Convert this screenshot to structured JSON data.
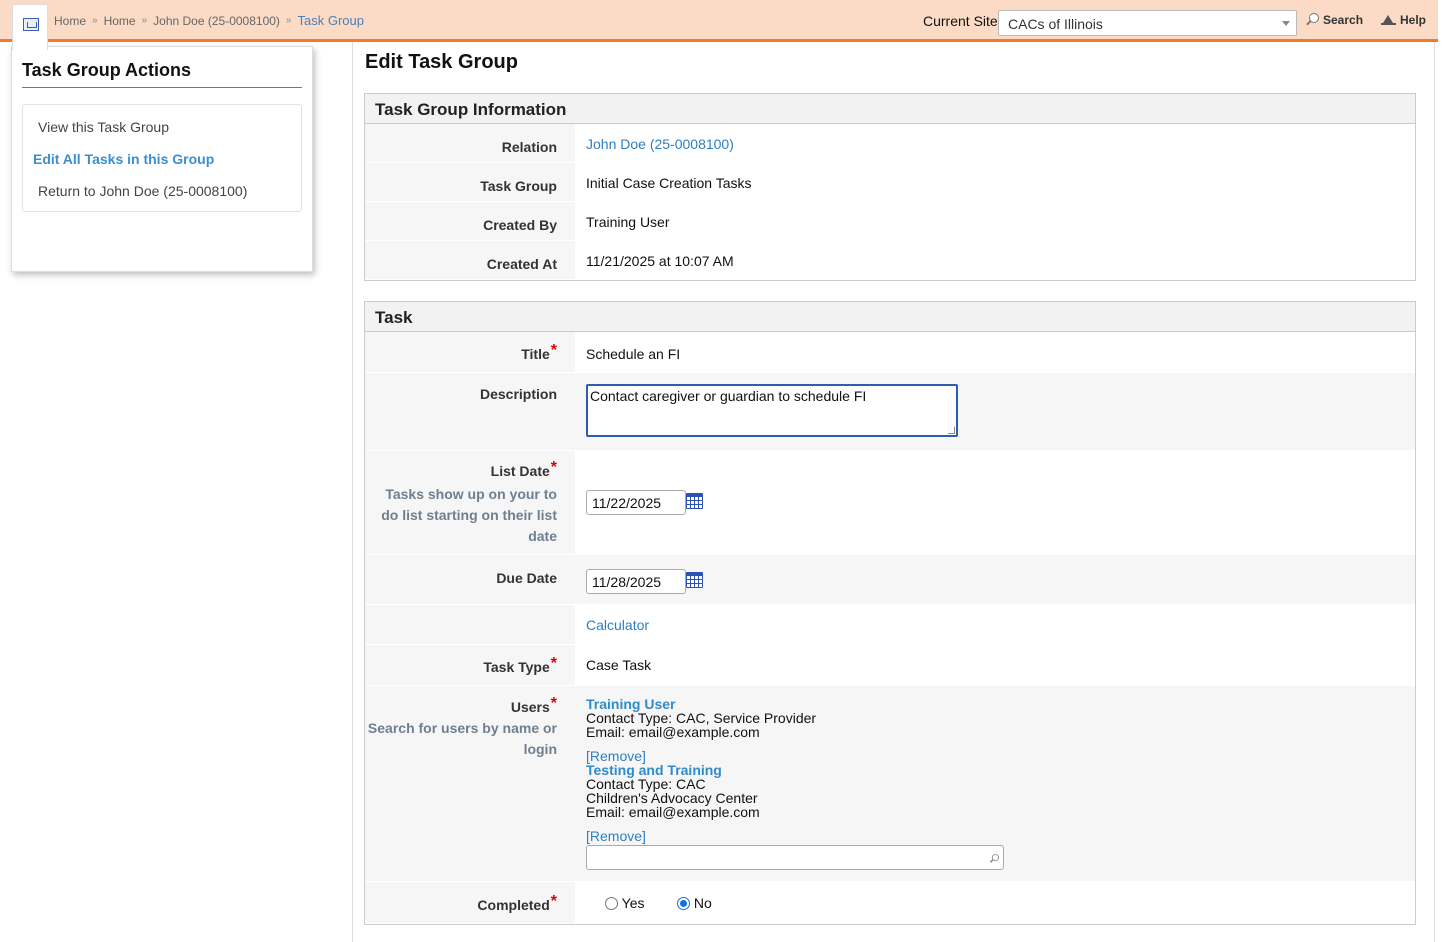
{
  "breadcrumb": {
    "items": [
      "Home",
      "Home",
      "John Doe (25-0008100)"
    ],
    "separator": "»",
    "current": "Task Group"
  },
  "header": {
    "current_site_label": "Current Site",
    "current_site_value": "CACs of Illinois",
    "search_label": "Search",
    "help_label": "Help"
  },
  "sidebar": {
    "title": "Task Group Actions",
    "items": [
      {
        "label": "View this Task Group"
      },
      {
        "label": "Edit All Tasks in this Group"
      },
      {
        "label": "Return to John Doe (25-0008100)"
      }
    ]
  },
  "page": {
    "title": "Edit Task Group"
  },
  "info_section": {
    "title": "Task Group Information",
    "relation_label": "Relation",
    "relation_value": "John Doe (25-0008100)",
    "task_group_label": "Task Group",
    "task_group_value": "Initial Case Creation Tasks",
    "created_by_label": "Created By",
    "created_by_value": "Training User",
    "created_at_label": "Created At",
    "created_at_value": "11/21/2025 at 10:07 AM"
  },
  "task_section": {
    "title": "Task",
    "required_mark": "*",
    "title_label": "Title",
    "title_value": "Schedule an FI",
    "description_label": "Description",
    "description_value": "Contact caregiver or guardian to schedule FI",
    "list_date_label": "List Date",
    "list_date_hint": "Tasks show up on your to do list starting on their list date",
    "list_date_value": "11/22/2025",
    "due_date_label": "Due Date",
    "due_date_value": "11/28/2025",
    "calculator_label": "Calculator",
    "task_type_label": "Task Type",
    "task_type_value": "Case Task",
    "users_label": "Users",
    "users_hint": "Search for users by name or login",
    "users": [
      {
        "name": "Training User",
        "lines": [
          "Contact Type: CAC, Service Provider",
          "Email: email@example.com"
        ],
        "remove_label": "[Remove]"
      },
      {
        "name": "Testing and Training",
        "lines": [
          "Contact Type: CAC",
          "Children's Advocacy Center",
          "Email: email@example.com"
        ],
        "remove_label": "[Remove]"
      }
    ],
    "completed_label": "Completed",
    "completed_yes": "Yes",
    "completed_no": "No",
    "completed_selected": "No"
  },
  "colors": {
    "topbar": "#fcdbc6",
    "topbar_border": "#f0792a",
    "link": "#2e7fc1",
    "required": "#dd0000"
  }
}
